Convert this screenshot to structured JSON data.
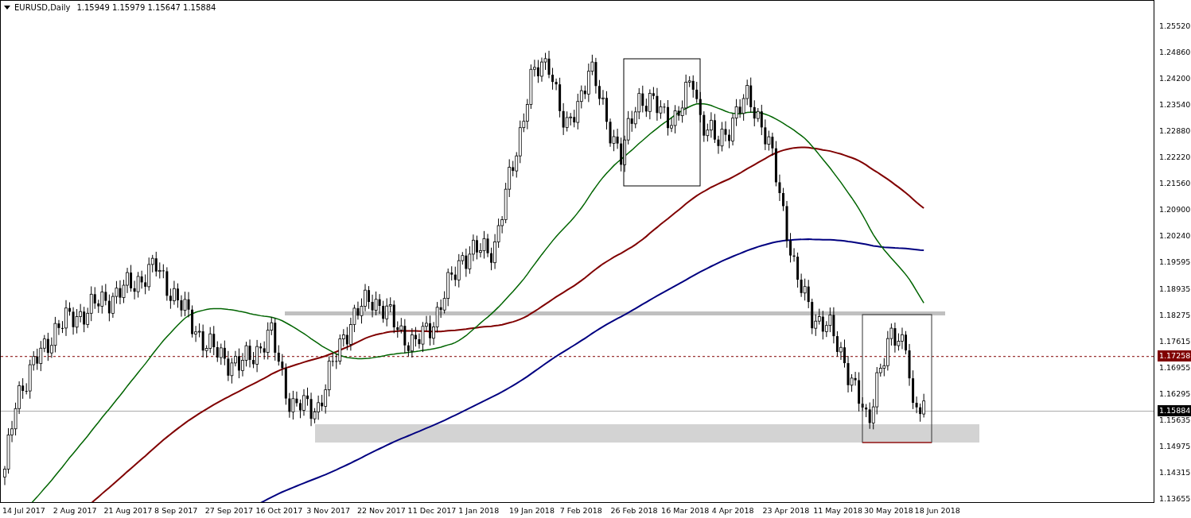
{
  "chart_title": {
    "symbol": "EURUSD,Daily",
    "ohlc": "1.15949 1.15979 1.15647 1.15884"
  },
  "price_axis": {
    "labels": [
      "1.25520",
      "1.24860",
      "1.24200",
      "1.23540",
      "1.22880",
      "1.22220",
      "1.21560",
      "1.20900",
      "1.20240",
      "1.19595",
      "1.18935",
      "1.18275",
      "1.17615",
      "1.16955",
      "1.16295",
      "1.15635",
      "1.14975",
      "1.14315",
      "1.13655"
    ],
    "markers": [
      {
        "kind": "alert",
        "label": "1.17258"
      },
      {
        "kind": "bid",
        "label": "1.15884"
      }
    ]
  },
  "time_axis": {
    "labels": [
      "14 Jul 2017",
      "2 Aug 2017",
      "21 Aug 2017",
      "8 Sep 2017",
      "27 Sep 2017",
      "16 Oct 2017",
      "3 Nov 2017",
      "22 Nov 2017",
      "11 Dec 2017",
      "1 Jan 2018",
      "19 Jan 2018",
      "7 Feb 2018",
      "26 Feb 2018",
      "16 Mar 2018",
      "4 Apr 2018",
      "23 Apr 2018",
      "11 May 2018",
      "30 May 2018",
      "18 Jun 2018"
    ]
  }
}
